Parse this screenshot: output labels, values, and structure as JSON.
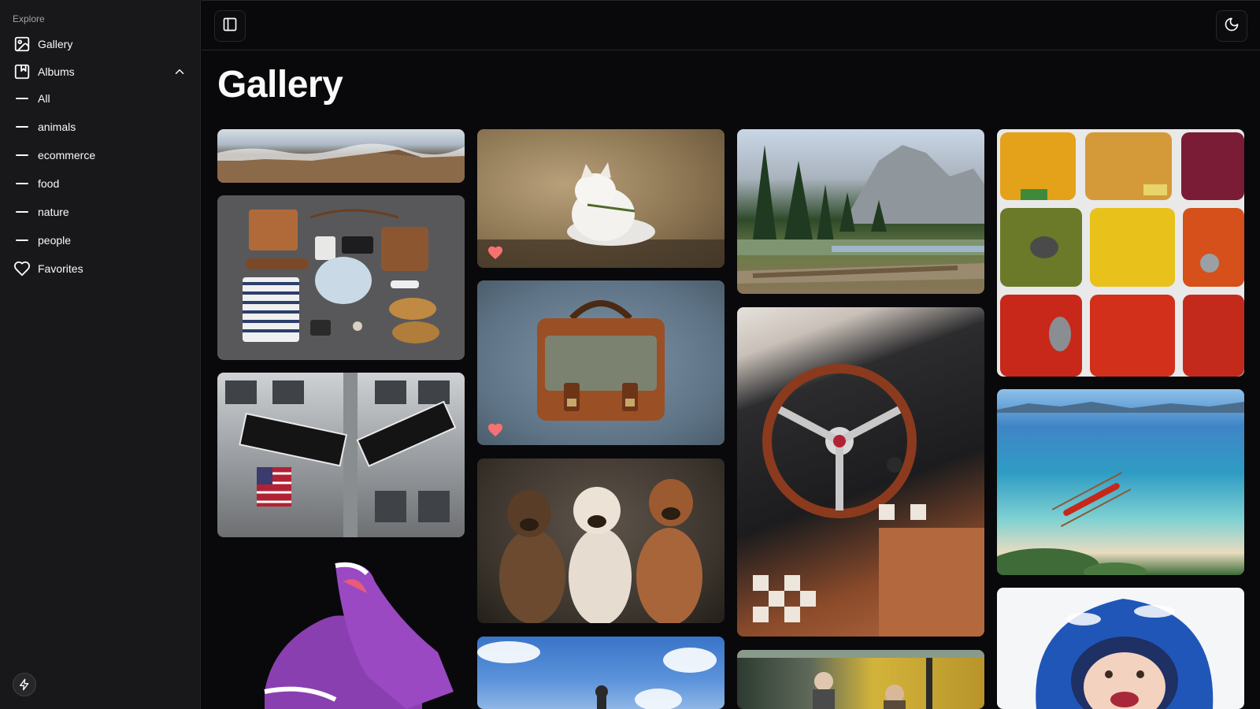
{
  "sidebar": {
    "section_label": "Explore",
    "items": [
      {
        "label": "Gallery",
        "icon": "image-icon"
      },
      {
        "label": "Albums",
        "icon": "album-icon",
        "expanded": true
      }
    ],
    "albums": [
      "All",
      "animals",
      "ecommerce",
      "food",
      "nature",
      "people"
    ],
    "favorites_label": "Favorites"
  },
  "header": {
    "toggle_sidebar_icon": "panel-left-icon",
    "theme_toggle_icon": "moon-icon"
  },
  "main": {
    "title": "Gallery"
  },
  "gallery": {
    "photos": [
      {
        "name": "mountain-landscape",
        "favorite": false
      },
      {
        "name": "flat-lay-accessories",
        "favorite": false
      },
      {
        "name": "broadway-morris-street-sign",
        "favorite": false
      },
      {
        "name": "purple-sneakers",
        "favorite": false
      },
      {
        "name": "white-kitten",
        "favorite": true
      },
      {
        "name": "leather-bag",
        "favorite": true
      },
      {
        "name": "three-dogs",
        "favorite": false
      },
      {
        "name": "blue-sky-scene",
        "favorite": false
      },
      {
        "name": "yosemite-valley",
        "favorite": false
      },
      {
        "name": "vintage-car-interior",
        "favorite": false
      },
      {
        "name": "autumn-street",
        "favorite": false
      },
      {
        "name": "spices-market",
        "favorite": false
      },
      {
        "name": "tropical-beach",
        "favorite": false
      },
      {
        "name": "child-in-snow",
        "favorite": false
      }
    ]
  },
  "colors": {
    "background": "#09090b",
    "sidebar_bg": "#18181b",
    "border": "#27272a",
    "text": "#fafafa",
    "favorite_heart": "#f87171"
  }
}
